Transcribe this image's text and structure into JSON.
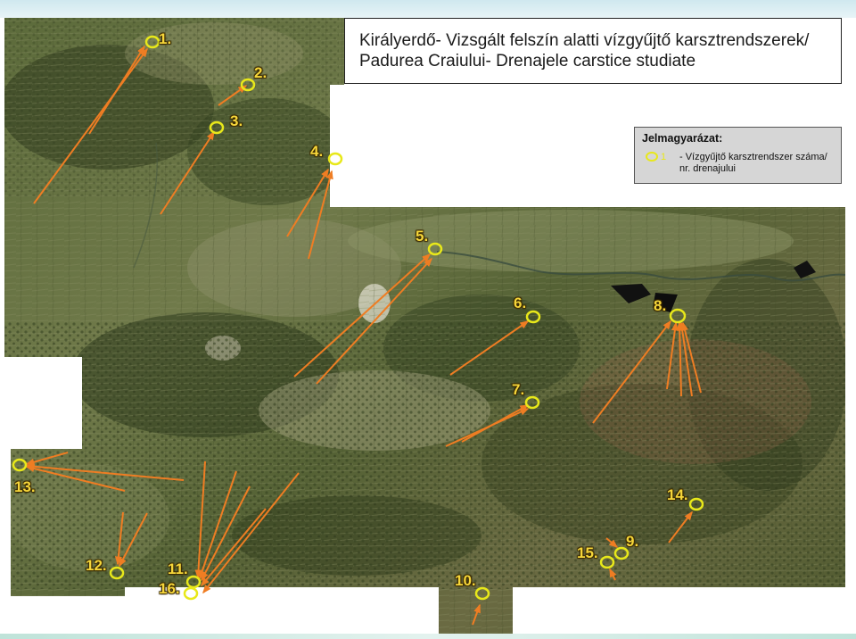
{
  "title": {
    "line1": "Királyerdő- Vizsgált felszín alatti vízgyűjtő karsztrendszerek/",
    "line2": "Padurea Craiului- Drenajele carstice studiate"
  },
  "legend": {
    "heading": "Jelmagyarázat:",
    "symbol_number": "1",
    "entry_line1": "- Vízgyűjtő karsztrendszer száma/",
    "entry_line2": "nr. drenajului"
  },
  "colors": {
    "marker": "#e8e81a",
    "arrow": "#ef7d23",
    "label": "#f6d63a"
  },
  "sites": [
    {
      "label": "1."
    },
    {
      "label": "2."
    },
    {
      "label": "3."
    },
    {
      "label": "4."
    },
    {
      "label": "5."
    },
    {
      "label": "6."
    },
    {
      "label": "7."
    },
    {
      "label": "8."
    },
    {
      "label": "9."
    },
    {
      "label": "10."
    },
    {
      "label": "11."
    },
    {
      "label": "12."
    },
    {
      "label": "13."
    },
    {
      "label": "14."
    },
    {
      "label": "15."
    },
    {
      "label": "16."
    }
  ]
}
